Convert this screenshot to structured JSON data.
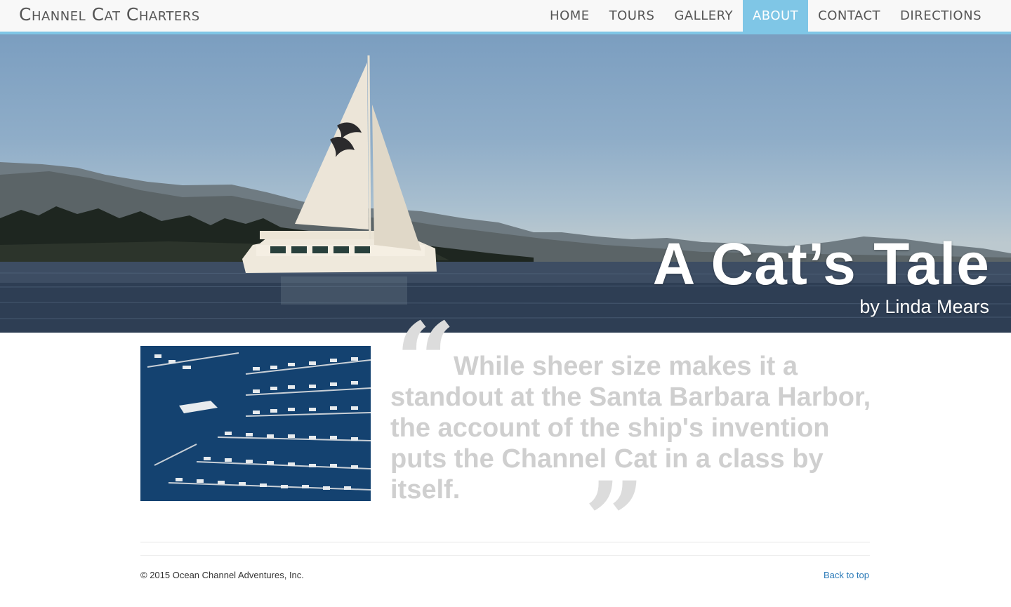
{
  "navbar": {
    "brand": "Channel Cat Charters",
    "items": [
      {
        "label": "HOME"
      },
      {
        "label": "TOURS"
      },
      {
        "label": "GALLERY"
      },
      {
        "label": "ABOUT",
        "active": true
      },
      {
        "label": "CONTACT"
      },
      {
        "label": "DIRECTIONS"
      }
    ]
  },
  "hero": {
    "title": "A Cat’s Tale",
    "byline": "by Linda Mears"
  },
  "quote": {
    "open_mark": "“",
    "text": "While sheer size makes it a standout at the Santa Barbara Harbor, the account of the ship's invention puts the Channel Cat in a class by itself.",
    "close_mark": "”"
  },
  "footer": {
    "copyright": "© 2015 Ocean Channel Adventures, Inc.",
    "back_to_top": "Back to top"
  },
  "colors": {
    "accent": "#7fc6e6",
    "nav_text": "#555555",
    "quote_text": "#cfcfcf",
    "link": "#2a7ab8"
  }
}
